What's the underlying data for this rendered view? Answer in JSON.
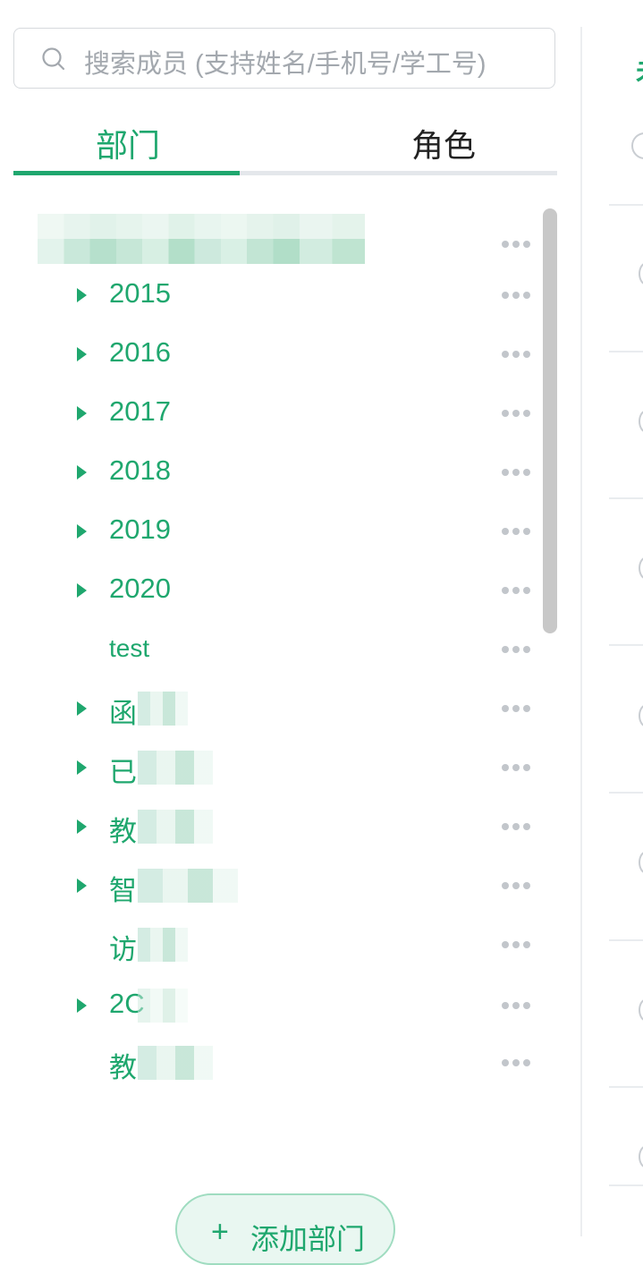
{
  "search": {
    "placeholder": "搜索成员 (支持姓名/手机号/学工号)"
  },
  "tabs": [
    {
      "label": "部门",
      "active": true
    },
    {
      "label": "角色",
      "active": false
    }
  ],
  "colors": {
    "accent": "#1fa76e",
    "text": "#222222",
    "muted": "#a3a8ae"
  },
  "tree": {
    "items": [
      {
        "label": "2015",
        "expandable": true
      },
      {
        "label": "2016",
        "expandable": true
      },
      {
        "label": "2017",
        "expandable": true
      },
      {
        "label": "2018",
        "expandable": true
      },
      {
        "label": "2019",
        "expandable": true
      },
      {
        "label": "2020",
        "expandable": true
      },
      {
        "label": "test",
        "expandable": false
      },
      {
        "label": "函",
        "expandable": true
      },
      {
        "label": "已",
        "expandable": true
      },
      {
        "label": "教",
        "expandable": true
      },
      {
        "label": "智",
        "expandable": true
      },
      {
        "label": "访",
        "expandable": false
      },
      {
        "label": "2C",
        "expandable": true
      },
      {
        "label": "教",
        "expandable": false
      }
    ]
  },
  "footer": {
    "add_plus": "+",
    "add_label": "添加部门"
  },
  "right": {
    "title_glyph": "未"
  }
}
